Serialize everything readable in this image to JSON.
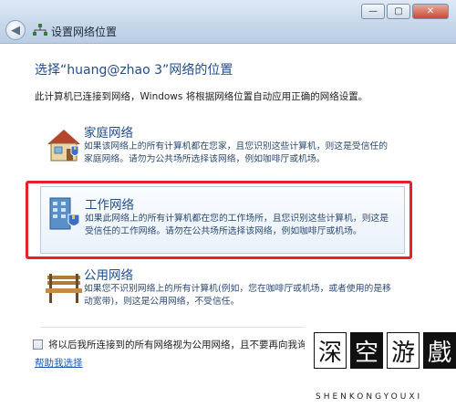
{
  "window": {
    "title": "设置网络位置",
    "minimize_glyph": "—",
    "maximize_glyph": "▢",
    "close_glyph": "✕",
    "back_glyph": "◀"
  },
  "main": {
    "heading": "选择“huang@zhao 3”网络的位置",
    "description": "此计算机已连接到网络，Windows 将根据网络位置自动应用正确的网络设置。"
  },
  "options": [
    {
      "title": "家庭网络",
      "description": "如果该网络上的所有计算机都在您家，且您识别这些计算机，则这是受信任的家庭网络。请勿为公共场所选择该网络，例如咖啡厅或机场。",
      "icon": "house-icon"
    },
    {
      "title": "工作网络",
      "description": "如果此网络上的所有计算机都在您的工作场所，且您识别这些计算机，则这是受信任的工作网络。请勿在公共场所选择该网络，例如咖啡厅或机场。",
      "icon": "office-building-icon"
    },
    {
      "title": "公用网络",
      "description": "如果您不识别网络上的所有计算机(例如，您在咖啡厅或机场，或者使用的是移动宽带)，则这是公用网络，不受信任。",
      "icon": "park-bench-icon"
    }
  ],
  "footer": {
    "checkbox_label": "将以后我所连接到的所有网络视为公用网络，且不要再向我询问。",
    "checkbox_checked": false,
    "help_link": "帮助我选择"
  },
  "watermark": {
    "chars": [
      "深",
      "空",
      "游",
      "戲"
    ],
    "text": "SHENKONGYOUXI"
  },
  "colors": {
    "heading": "#1f4d8c",
    "link": "#1a5bb5",
    "highlight_border": "#e8202a"
  }
}
